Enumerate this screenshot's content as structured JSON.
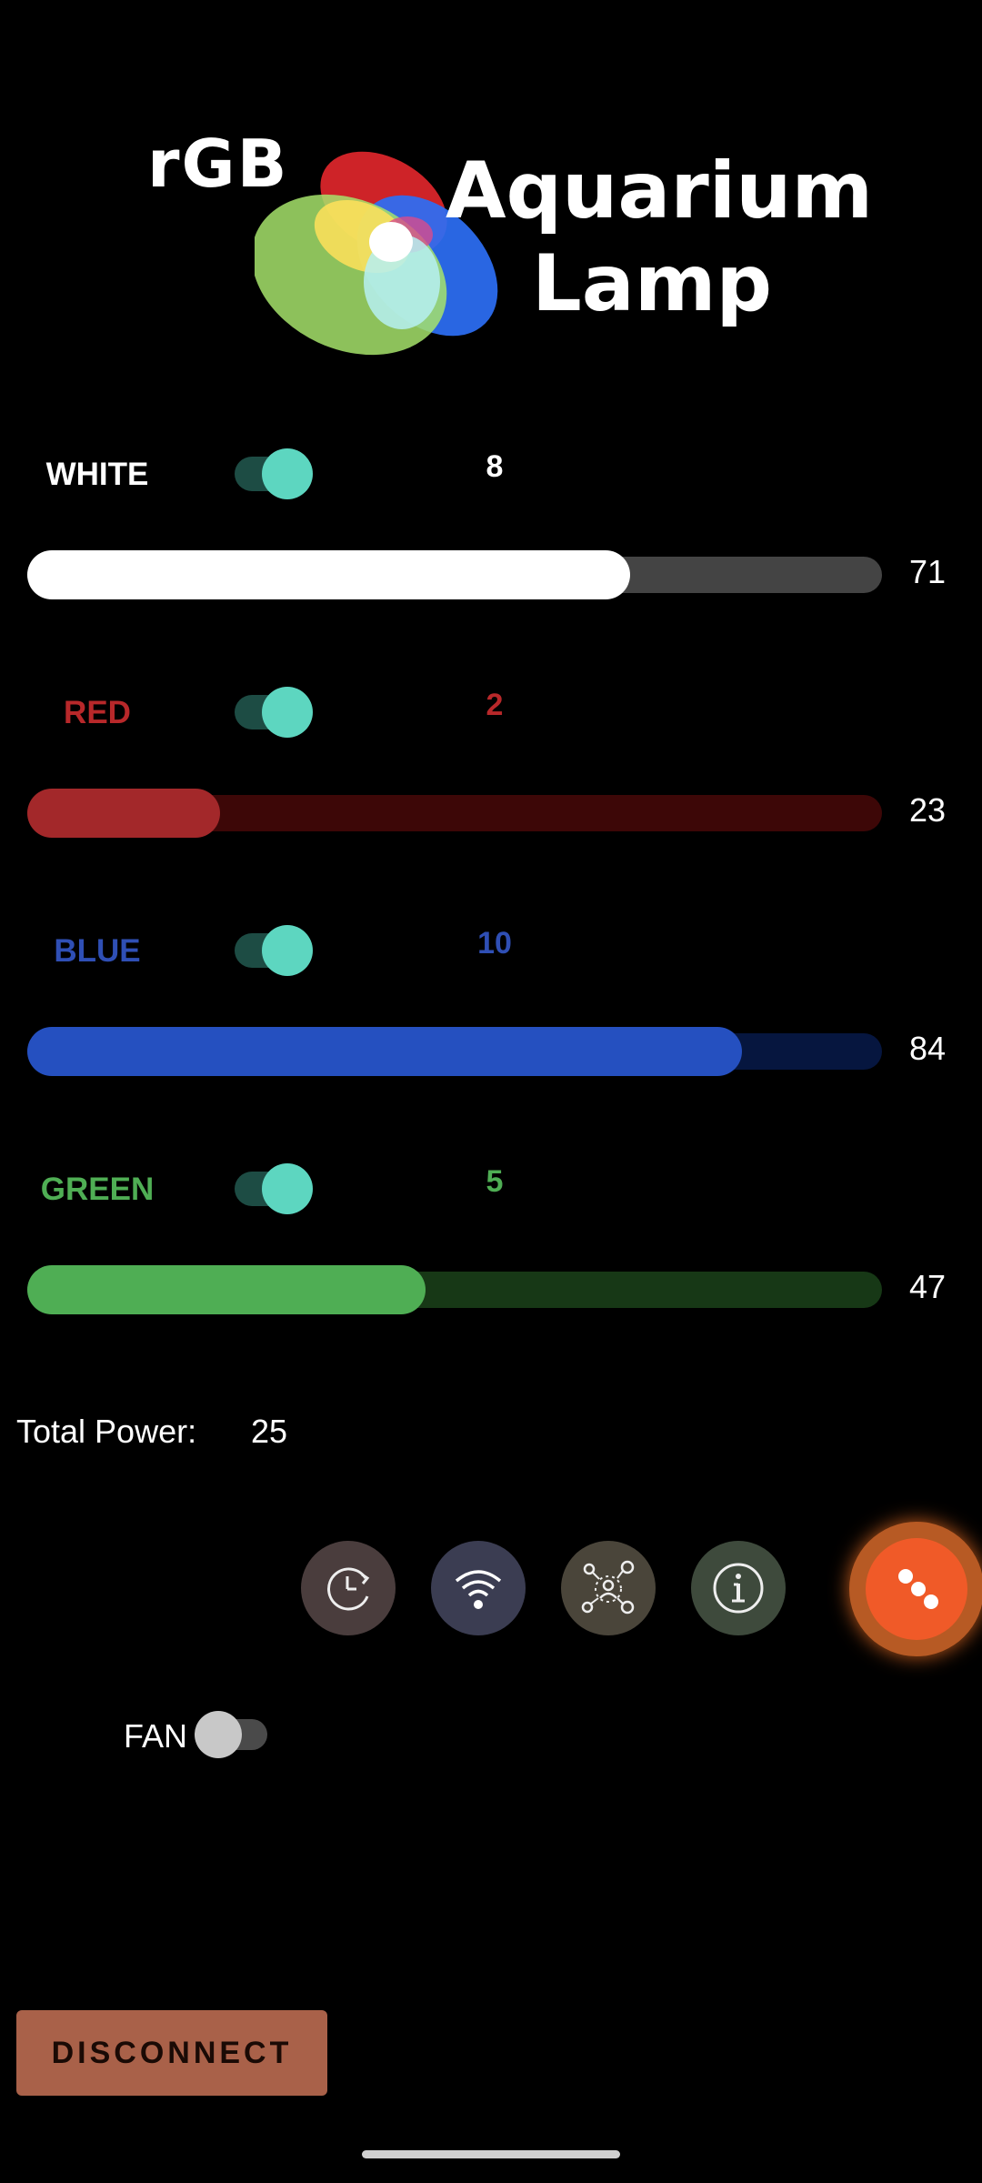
{
  "logo": {
    "rgb": "rGB",
    "line1": "Aquarium",
    "line2": "Lamp"
  },
  "channels": [
    {
      "label": "WHITE",
      "count": "8",
      "value": "71",
      "level": 71,
      "enabled": true,
      "label_color": "#ffffff",
      "fill_color": "#ffffff",
      "track_color": "#444444"
    },
    {
      "label": "RED",
      "count": "2",
      "value": "23",
      "level": 23,
      "enabled": true,
      "label_color": "#b8282a",
      "fill_color": "#a3282a",
      "track_color": "#3d0707"
    },
    {
      "label": "BLUE",
      "count": "10",
      "value": "84",
      "level": 84,
      "enabled": true,
      "label_color": "#2f4fb5",
      "fill_color": "#2550c0",
      "track_color": "#06163f"
    },
    {
      "label": "GREEN",
      "count": "5",
      "value": "47",
      "level": 47,
      "enabled": true,
      "label_color": "#4fae54",
      "fill_color": "#4fae54",
      "track_color": "#173816"
    }
  ],
  "power": {
    "label": "Total Power:",
    "value": "25"
  },
  "icons": [
    {
      "name": "schedule-icon",
      "bg": "#4a3d3d"
    },
    {
      "name": "wifi-icon",
      "bg": "#3b3d52"
    },
    {
      "name": "network-icon",
      "bg": "#4a453a"
    },
    {
      "name": "info-icon",
      "bg": "#3e4a3c"
    }
  ],
  "fab": {
    "name": "dice-icon",
    "color": "#f05a28"
  },
  "fan": {
    "label": "FAN",
    "enabled": false
  },
  "disconnect_label": "DISCONNECT"
}
